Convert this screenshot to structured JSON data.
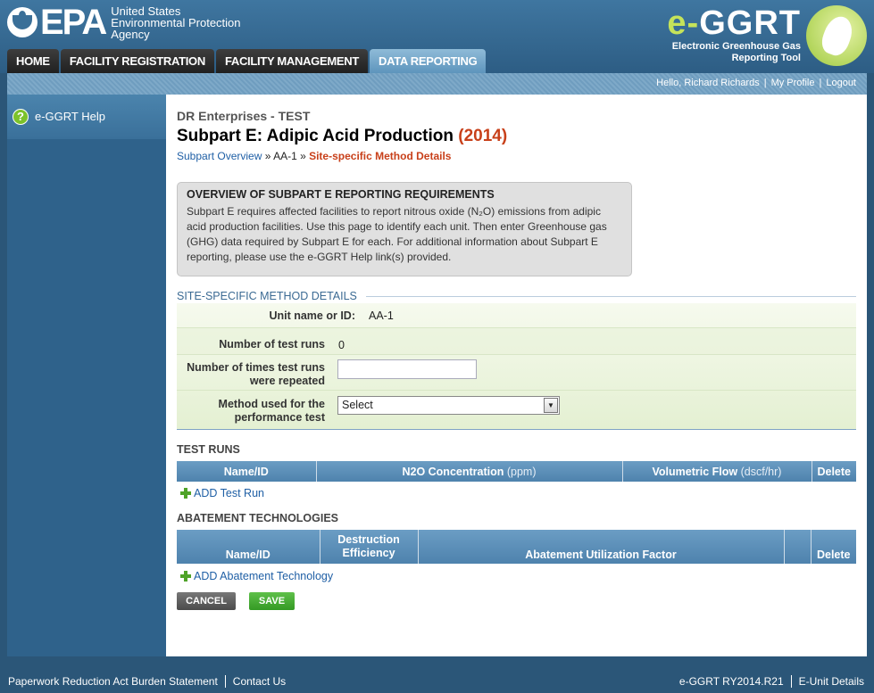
{
  "header": {
    "agency_line1": "United States",
    "agency_line2": "Environmental Protection",
    "agency_line3": "Agency",
    "epa_word": "EPA",
    "app_title_e": "e-",
    "app_title_rest": "GGRT",
    "app_subtitle1": "Electronic Greenhouse Gas",
    "app_subtitle2": "Reporting Tool"
  },
  "nav": {
    "tabs": [
      "HOME",
      "FACILITY REGISTRATION",
      "FACILITY MANAGEMENT",
      "DATA REPORTING"
    ],
    "active_index": 3
  },
  "userbar": {
    "greeting": "Hello, Richard Richards",
    "profile": "My Profile",
    "logout": "Logout",
    "sep": "|"
  },
  "sidebar": {
    "help_icon": "?",
    "help_label": "e-GGRT Help"
  },
  "main": {
    "company": "DR Enterprises - TEST",
    "title": "Subpart E: Adipic Acid Production",
    "year": "(2014)",
    "breadcrumb": {
      "overview": "Subpart Overview",
      "sep": " » ",
      "unit": "AA-1",
      "current": "Site-specific Method Details"
    },
    "overview_box": {
      "heading": "OVERVIEW OF SUBPART E REPORTING REQUIREMENTS",
      "text": "Subpart E requires affected facilities to report nitrous oxide (N₂O) emissions from adipic acid production facilities. Use this page to identify each unit. Then enter Greenhouse gas (GHG) data required by Subpart E for each. For additional information about Subpart E reporting, please use the e-GGRT Help link(s) provided."
    },
    "method_section": {
      "heading": "SITE-SPECIFIC METHOD DETAILS",
      "unit_label": "Unit name or ID:",
      "unit_value": "AA-1",
      "runs_label": "Number of test runs",
      "runs_value": "0",
      "repeated_label1": "Number of times test runs",
      "repeated_label2": "were repeated",
      "repeated_value": "",
      "method_label1": "Method used for the",
      "method_label2": "performance test",
      "method_selected": "Select"
    },
    "test_runs": {
      "heading": "TEST RUNS",
      "col_name": "Name/ID",
      "col_n2o": "N2O Concentration",
      "col_n2o_unit": "(ppm)",
      "col_flow": "Volumetric Flow",
      "col_flow_unit": "(dscf/hr)",
      "col_delete": "Delete",
      "add_link": "ADD Test Run"
    },
    "abatement": {
      "heading": "ABATEMENT TECHNOLOGIES",
      "col_name": "Name/ID",
      "col_destruction1": "Destruction",
      "col_destruction2": "Efficiency",
      "col_factor": "Abatement Utilization Factor",
      "col_delete": "Delete",
      "add_link": "ADD Abatement Technology"
    },
    "buttons": {
      "cancel": "CANCEL",
      "save": "SAVE"
    }
  },
  "footer": {
    "paperwork": "Paperwork Reduction Act Burden Statement",
    "contact": "Contact Us",
    "version": "e-GGRT RY2014.R21",
    "eunit": "E-Unit Details"
  }
}
